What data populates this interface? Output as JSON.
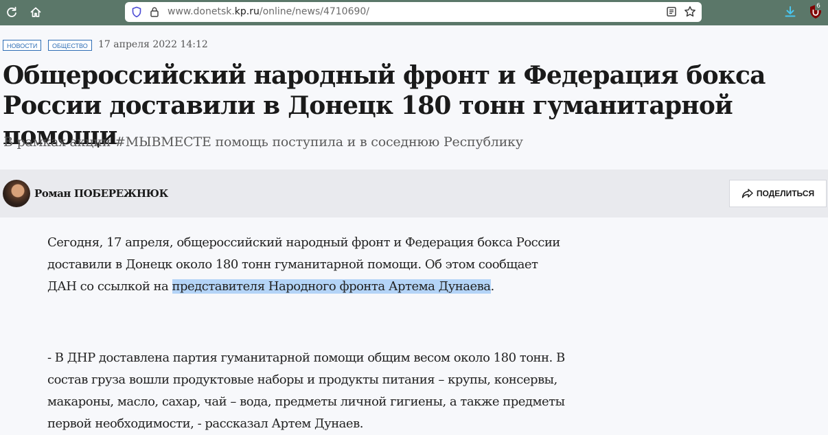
{
  "browser": {
    "url_prefix": "www.donetsk.",
    "url_host": "kp.ru",
    "url_path": "/online/news/4710690/",
    "extension_badge": "6"
  },
  "article": {
    "tags": [
      "НОВОСТИ",
      "ОБЩЕСТВО"
    ],
    "date": "17 апреля 2022 14:12",
    "title": "Общероссийский народный фронт и Федерация бокса России доставили в Донецк 180 тонн гуманитарной помощи",
    "subtitle": "В рамках акции #МЫВМЕСТЕ помощь поступила и в соседнюю Республику",
    "author": "Роман ПОБЕРЕЖНЮК",
    "share_label": "ПОДЕЛИТЬСЯ",
    "p1_before": "Сегодня, 17 апреля, общероссийский народный фронт и Федерация бокса России доставили в Донецк около 180 тонн гуманитарной помощи. Об этом сообщает ДАН со ссылкой на ",
    "p1_link": "представителя Народного фронта Артема Дунаева",
    "p1_after": ".",
    "p2": "- В ДНР доставлена партия гуманитарной помощи общим весом около 180 тонн. В состав груза вошли продуктовые наборы и продукты питания – крупы, консервы, макароны, масло, сахар, чай – вода, предметы личной гигиены, а также предметы первой необходимости, - рассказал Артем Дунаев."
  }
}
